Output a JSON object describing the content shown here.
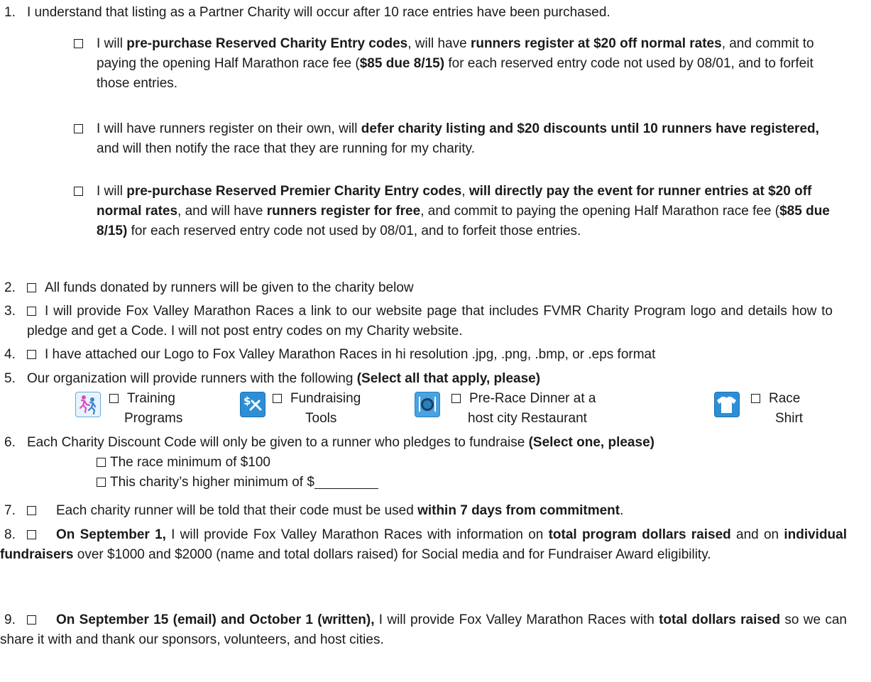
{
  "items": {
    "i1": {
      "num": "1.",
      "text": "I understand that listing as a Partner Charity will occur after 10 race entries have been purchased.",
      "subs": [
        {
          "p1": "I will ",
          "b1": "pre-purchase Reserved Charity Entry codes",
          "p2": ", will have ",
          "b2": "runners register at $20 off normal rates",
          "p3": ", and commit to paying the opening Half Marathon race fee (",
          "b3": "$85 due 8/15)",
          "p4": " for each reserved entry code not used by 08/01, and to forfeit those entries."
        },
        {
          "p1": "I will have runners register on their own, will ",
          "b1": "defer charity listing and $20 discounts until 10 runners have registered,",
          "p2": " and will then notify the race that they are running for my charity."
        },
        {
          "p1": "I will ",
          "b1": "pre-purchase Reserved Premier Charity Entry codes",
          "p2": ", ",
          "b2": "will directly pay the event for runner entries at $20 off normal rates",
          "p3": ", and will have ",
          "b3": "runners register for free",
          "p4": ", and commit to paying the opening Half Marathon race fee (",
          "b4": "$85 due 8/15)",
          "p5": " for each reserved entry code not used by 08/01, and to forfeit those entries."
        }
      ]
    },
    "i2": {
      "num": "2.",
      "text": "All funds donated by runners will be given to the charity below"
    },
    "i3": {
      "num": "3.",
      "text": "I will provide Fox Valley Marathon Races a link to our website page that includes FVMR Charity Program logo and details how to pledge and get a Code. I will not post entry codes on my Charity website."
    },
    "i4": {
      "num": "4.",
      "text": "I have attached our Logo to Fox Valley Marathon Races in hi resolution .jpg, .png, .bmp, or .eps format"
    },
    "i5": {
      "num": "5.",
      "text": "Our organization will provide runners with the following ",
      "bold": "(Select all that apply, please)",
      "options": [
        {
          "l1": "Training",
          "l2": "Programs",
          "icon": "runners-icon"
        },
        {
          "l1": "Fundraising",
          "l2": "Tools",
          "icon": "dollar-tools-icon"
        },
        {
          "l1": "Pre-Race Dinner at a",
          "l2": "host city Restaurant",
          "icon": "dinner-plate-icon"
        },
        {
          "l1": "Race",
          "l2": "Shirt",
          "icon": "shirt-icon"
        }
      ]
    },
    "i6": {
      "num": "6.",
      "text": "Each Charity Discount Code will only be given to a runner who pledges to fundraise ",
      "bold": "(Select one, please)",
      "opt1": "The race minimum of $100",
      "opt2": "This charity’s higher minimum of $"
    },
    "i7": {
      "num": "7.",
      "p1": "Each charity runner will be told that their code must be used ",
      "b1": "within 7 days from commitment",
      "p2": "."
    },
    "i8": {
      "num": "8.",
      "b1": "On September 1,",
      "p1": " I will provide Fox Valley Marathon Races with information on ",
      "b2": "total program dollars raised",
      "p2": " and on ",
      "b3": "individual fundraisers",
      "p3": " over $1000 and $2000 (name and total dollars raised) for Social media and for Fundraiser Award eligibility."
    },
    "i9": {
      "num": "9.",
      "b1": "On September 15 (email) and October 1 (written),",
      "p1": " I will provide Fox Valley Marathon Races with ",
      "b2": "total dollars raised",
      "p2": " so we can share it with and thank our sponsors, volunteers, and host cities."
    }
  }
}
